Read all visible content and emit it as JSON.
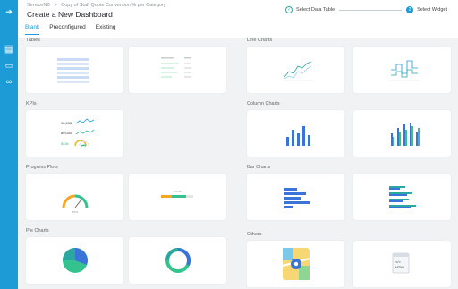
{
  "breadcrumb": [
    "ServiceNB",
    ">",
    "Copy of Staff Quote Conversion % per Category"
  ],
  "page_title": "Create a New Dashboard",
  "steps": [
    {
      "number": "✓",
      "label": "Select Data Table"
    },
    {
      "number": "2",
      "label": "Select Widget"
    }
  ],
  "tabs": [
    "Blank",
    "Preconfigured",
    "Existing"
  ],
  "sections": {
    "tables": "Tables",
    "kpis": "KPIs",
    "progress_plots": "Progress Plots",
    "pie_charts": "Pie Charts",
    "line_charts": "Line Charts",
    "column_charts": "Column Charts",
    "bar_charts": "Bar Charts",
    "others": "Others"
  },
  "kpi_values": [
    "90,000",
    "80,000",
    "$45k"
  ],
  "gauge_value": "65%",
  "progress_value": "12.98",
  "html_label": "</>",
  "html_text": "HTML",
  "colors": {
    "accent": "#1c9bd7",
    "rail": "#1c9bd7",
    "teal": "#2aa7a0",
    "green": "#34c38f"
  },
  "icons": [
    "logout-icon",
    "dashboard-icon",
    "report-icon",
    "link-icon"
  ]
}
